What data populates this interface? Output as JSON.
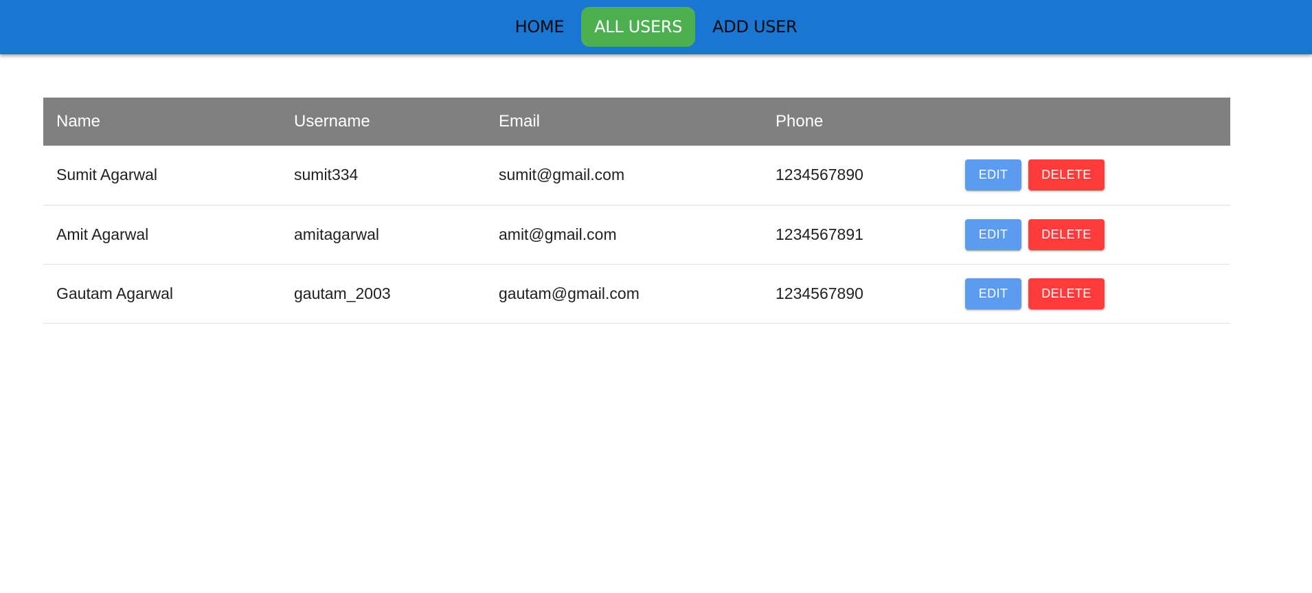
{
  "nav": {
    "items": [
      {
        "label": "HOME",
        "active": false
      },
      {
        "label": "ALL USERS",
        "active": true
      },
      {
        "label": "ADD USER",
        "active": false
      }
    ]
  },
  "table": {
    "headers": [
      "Name",
      "Username",
      "Email",
      "Phone",
      ""
    ],
    "rows": [
      {
        "name": "Sumit Agarwal",
        "username": "sumit334",
        "email": "sumit@gmail.com",
        "phone": "1234567890"
      },
      {
        "name": "Amit Agarwal",
        "username": "amitagarwal",
        "email": "amit@gmail.com",
        "phone": "1234567891"
      },
      {
        "name": "Gautam Agarwal",
        "username": "gautam_2003",
        "email": "gautam@gmail.com",
        "phone": "1234567890"
      }
    ],
    "edit_label": "EDIT",
    "delete_label": "DELETE"
  },
  "colors": {
    "app_bar": "#1976d2",
    "active_tab": "#4caf50",
    "header_row": "#808080",
    "edit_button": "#5b9bf0",
    "delete_button": "#ff3b3b"
  }
}
